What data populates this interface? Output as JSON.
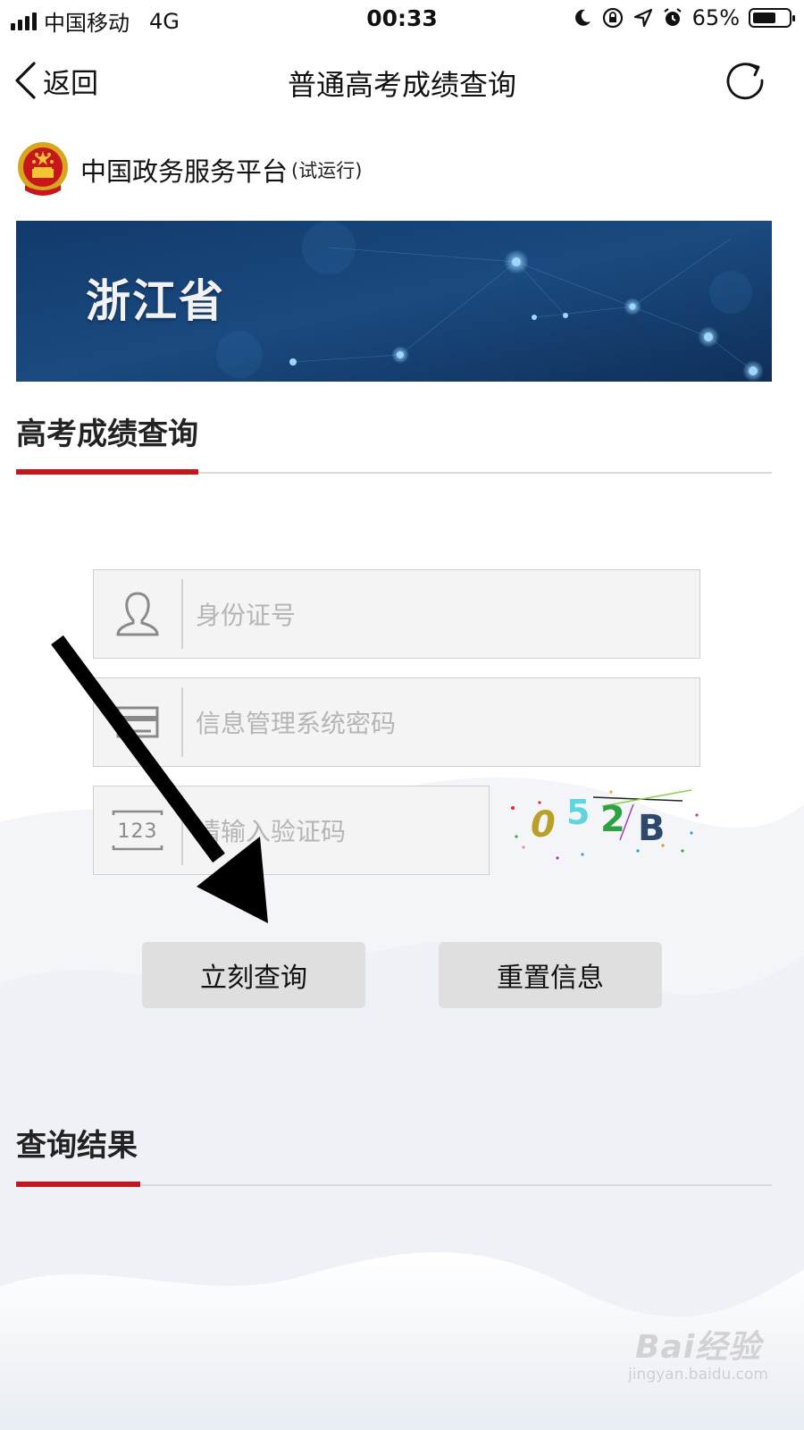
{
  "status_bar": {
    "carrier": "中国移动",
    "network": "4G",
    "time": "00:33",
    "battery": "65%",
    "battery_level": 0.65,
    "icons": [
      "moon-icon",
      "rotation-lock-icon",
      "location-icon",
      "alarm-icon"
    ]
  },
  "nav": {
    "back_label": "返回",
    "title": "普通高考成绩查询"
  },
  "platform": {
    "name": "中国政务服务平台",
    "note": "(试运行)"
  },
  "banner": {
    "title": "浙江省"
  },
  "query_section": {
    "title": "高考成绩查询"
  },
  "form": {
    "id_placeholder": "身份证号",
    "password_placeholder": "信息管理系统密码",
    "captcha_placeholder": "请输入验证码",
    "captcha_text": "052B",
    "captcha_chars": [
      "0",
      "5",
      "2",
      "B"
    ],
    "icon_123": "123"
  },
  "buttons": {
    "query": "立刻查询",
    "reset": "重置信息"
  },
  "result_section": {
    "title": "查询结果"
  },
  "watermark": {
    "brand": "Bai经验",
    "url": "jingyan.baidu.com"
  },
  "colors": {
    "accent_red": "#c4161c",
    "banner_blue": "#1a4a80",
    "button_gray": "#dfdfdf",
    "field_bg": "#f4f4f4"
  }
}
